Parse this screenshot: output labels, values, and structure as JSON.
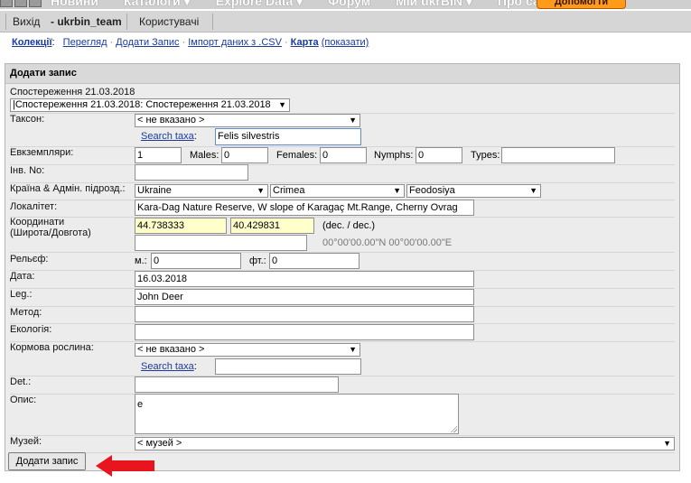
{
  "nav": {
    "menu": [
      "Новини",
      "Каталоги ▾",
      "Explore Data ▾",
      "Форум",
      "Мій ukrBIN ▾",
      "Про сайт ▾"
    ],
    "donate": "Допомогти проекту"
  },
  "userbar": {
    "logout": "Вихід",
    "user": "- ukrbin_team",
    "users": "Користувачі"
  },
  "submenu": {
    "collections": "Колекції",
    "view": "Перегляд",
    "add": "Додати Запис",
    "import": "Імпорт даних з .CSV",
    "map": "Карта",
    "map_show": "(показати)"
  },
  "form": {
    "title": "Додати запис",
    "observation_label": "Спостереження 21.03.2018",
    "observation_select": "|Спостереження 21.03.2018: Спостереження 21.03.2018",
    "taxon_label": "Таксон:",
    "taxon_select": "< не вказано >",
    "search_taxa": "Search taxa",
    "taxon_search_value": "Felis silvestris",
    "specimens_label": "Евкземпляри:",
    "specimens_value": "1",
    "males_label": "Males:",
    "males_value": "0",
    "females_label": "Females:",
    "females_value": "0",
    "nymphs_label": "Nymphs:",
    "nymphs_value": "0",
    "types_label": "Types:",
    "types_value": "",
    "inv_label": "Інв. No:",
    "inv_value": "",
    "country_label": "Країна & Адмін. підрозд.:",
    "country": "Ukraine",
    "region": "Crimea",
    "district": "Feodosiya",
    "locality_label": "Локалітет:",
    "locality_value": "Kara-Dag Nature Reserve, W slope of Karagaç Mt.Range, Cherny Ovrag",
    "coords_label_1": "Координати",
    "coords_label_2": "(Широта/Довгота)",
    "lat": "44.738333",
    "lon": "40.429831",
    "coord_hint": "(dec. / dec.)",
    "coord_dms": "00°00'00.00\"N 00°00'00.00\"E",
    "coord_extra": "",
    "relief_label": "Рельєф:",
    "m_label": "м.:",
    "m_value": "0",
    "ft_label": "фт.:",
    "ft_value": "0",
    "date_label": "Дата:",
    "date_value": "16.03.2018",
    "leg_label": "Leg.:",
    "leg_value": "John Deer",
    "method_label": "Метод:",
    "method_value": "",
    "ecology_label": "Екологія:",
    "ecology_value": "",
    "plant_label": "Кормова рослина:",
    "plant_select": "< не вказано >",
    "plant_search_value": "",
    "det_label": "Det.:",
    "det_value": "",
    "desc_label": "Опис:",
    "desc_value": "e",
    "museum_label": "Музей:",
    "museum_select": "< музей >",
    "submit": "Додати запис"
  },
  "colors": {
    "link": "#1a3a9e",
    "highlight": "#ffffcc",
    "arrow": "#e8141e",
    "donate": "#ff9a1a"
  }
}
